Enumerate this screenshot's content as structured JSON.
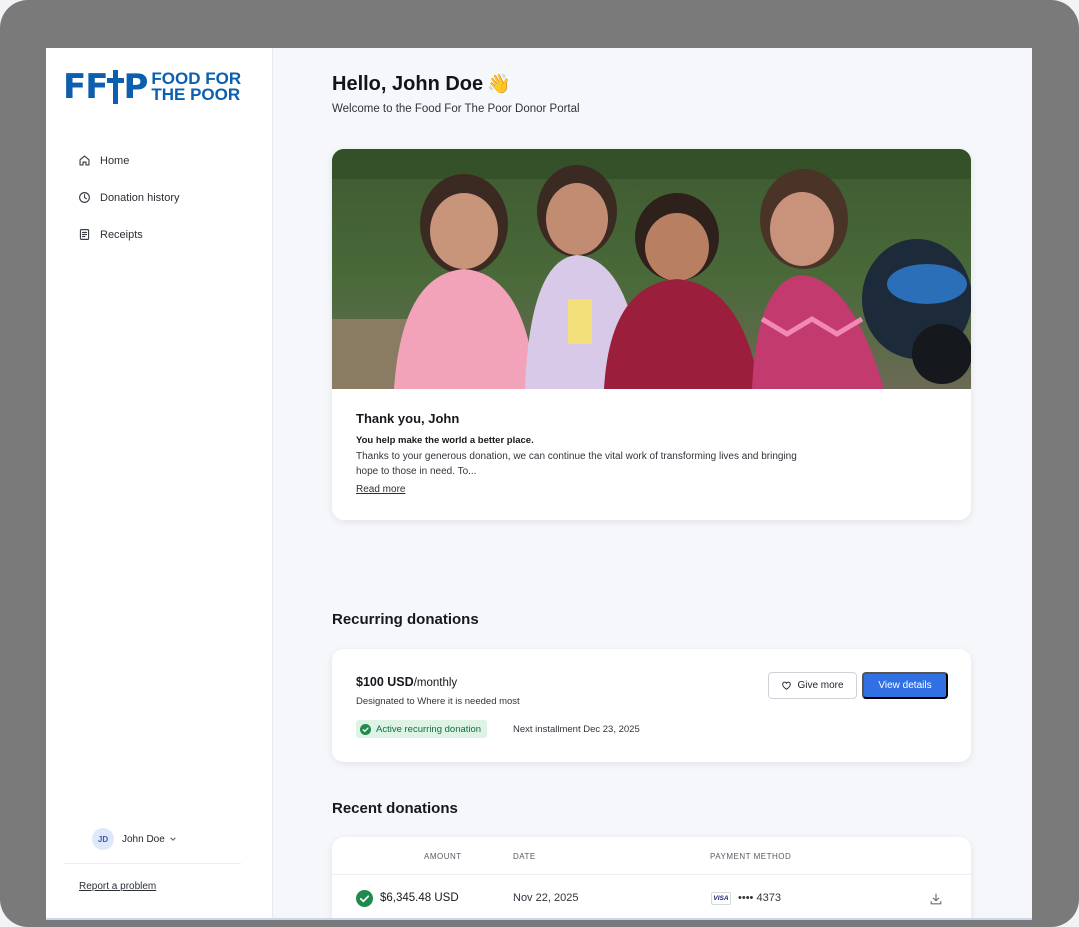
{
  "brand": {
    "logo_mark_left": "FF",
    "logo_mark_right": "P",
    "logo_text": "FOOD FOR\nTHE POOR",
    "color": "#0b5fae"
  },
  "sidebar": {
    "items": [
      {
        "label": "Home",
        "icon": "home-icon"
      },
      {
        "label": "Donation history",
        "icon": "clock-icon"
      },
      {
        "label": "Receipts",
        "icon": "receipt-icon"
      }
    ],
    "user": {
      "initials": "JD",
      "name": "John Doe"
    },
    "report_link": "Report a problem"
  },
  "header": {
    "greeting": "Hello, John Doe",
    "wave": "👋",
    "subtitle": "Welcome to the Food For The Poor Donor Portal"
  },
  "hero": {
    "title": "Thank you, John",
    "lead": "You help make the world a better place.",
    "text": "Thanks to your generous donation, we can continue the vital work of transforming lives and bringing hope to those in need. To...",
    "read_more": "Read more"
  },
  "recurring": {
    "section_title": "Recurring donations",
    "amount": "$100 USD",
    "frequency": "/monthly",
    "designation": "Designated to Where it is needed most",
    "status": "Active recurring donation",
    "next_installment": "Next installment Dec 23, 2025",
    "give_more_label": "Give more",
    "view_details_label": "View details",
    "accent": "#3170e3",
    "status_color": "#146c3c"
  },
  "recent": {
    "section_title": "Recent donations",
    "columns": [
      "AMOUNT",
      "DATE",
      "PAYMENT METHOD"
    ],
    "rows": [
      {
        "amount": "$6,345.48 USD",
        "date": "Nov 22, 2025",
        "card_brand": "VISA",
        "card_masked": "•••• 4373"
      }
    ]
  }
}
